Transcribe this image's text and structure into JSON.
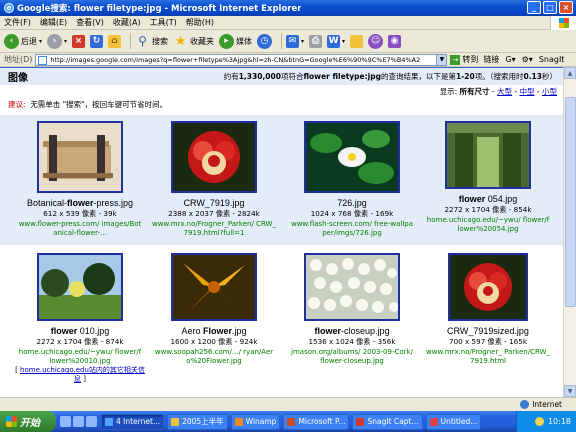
{
  "window": {
    "title": "Google搜索: flower filetype:jpg - Microsoft Internet Explorer",
    "minimize": "_",
    "maximize": "□",
    "close": "×"
  },
  "menu": [
    "文件(F)",
    "编辑(E)",
    "查看(V)",
    "收藏(A)",
    "工具(T)",
    "帮助(H)"
  ],
  "toolbar": {
    "back": "后退",
    "search": "搜索",
    "favorites": "收藏夹",
    "media": "媒体"
  },
  "address": {
    "label": "地址(D)",
    "url": "http://images.google.com/images?q=flower+filetype%3Ajpg&hl=zh-CN&btnG=Google%E6%90%9C%E7%B4%A2",
    "go": "转到",
    "links": "链接",
    "snagit": "SnagIt"
  },
  "results": {
    "heading": "图像",
    "stats_prefix": "约有",
    "stats_count": "1,330,000",
    "stats_mid": "项符合",
    "stats_query": "flower filetype:jpg",
    "stats_suffix": "的查询结果，以下是第",
    "stats_range": "1-20",
    "stats_tail": "项。（搜索用时",
    "stats_time": "0.13",
    "stats_end": "秒）",
    "size_label": "显示:",
    "size_all": "所有尺寸",
    "size_large": "大型",
    "size_medium": "中型",
    "size_small": "小型",
    "tip_label": "建议:",
    "tip_text": "无需单击 \"搜索\"，按回车键可节省时间。",
    "row1": [
      {
        "name_pre": "Botanical-",
        "name_bold": "flower",
        "name_post": "-press.jpg",
        "dims": "612 x 539 像素 - 39k",
        "url": "www.flower-press.com/ images/Botanical-flower-..."
      },
      {
        "name_pre": "CRW_7919.jpg",
        "name_bold": "",
        "name_post": "",
        "dims": "2388 x 2037 像素 - 2824k",
        "url": "www.mrx.no/Frogner_Parken/ CRW_7919.html?full=1"
      },
      {
        "name_pre": "726.jpg",
        "name_bold": "",
        "name_post": "",
        "dims": "1024 x 768 像素 - 169k",
        "url": "www.flash-screen.com/ free-wallpaper/imgs/726.jpg"
      },
      {
        "name_pre": "",
        "name_bold": "flower",
        "name_post": " 054.jpg",
        "dims": "2272 x 1704 像素 - 854k",
        "url": "home.uchicago.edu/~ywu/ flower/flower%20054.jpg"
      }
    ],
    "row2": [
      {
        "name_pre": "",
        "name_bold": "flower",
        "name_post": " 010.jpg",
        "dims": "2272 x 1704 像素 - 874k",
        "url": "home.uchicago.edu/~ywu/ flower/flower%20010.jpg",
        "more_text": "home.uchicago.edu站内的其它相关信息"
      },
      {
        "name_pre": "Aero ",
        "name_bold": "Flower",
        "name_post": ".jpg",
        "dims": "1600 x 1200 像素 - 924k",
        "url": "www.soopah256.com/.../ ryan/Aero%20Flower.jpg"
      },
      {
        "name_pre": "",
        "name_bold": "flower",
        "name_post": "-closeup.jpg",
        "dims": "1536 x 1024 像素 - 356k",
        "url": "jmason.org/albums/ 2003-09-Cork/flower-closeup.jpg"
      },
      {
        "name_pre": "CRW_7919sized.jpg",
        "name_bold": "",
        "name_post": "",
        "dims": "700 x 597 像素 - 165k",
        "url": "www.mrx.no/Frogner_ Parken/CRW_7919.html"
      }
    ]
  },
  "status": {
    "zone": "Internet"
  },
  "taskbar": {
    "start": "开始",
    "tasks": [
      "4 Internet...",
      "2005上半年",
      "Winamp",
      "Microsoft P...",
      "SnagIt Capt...",
      "Untitled..."
    ],
    "clock": "10:18"
  }
}
